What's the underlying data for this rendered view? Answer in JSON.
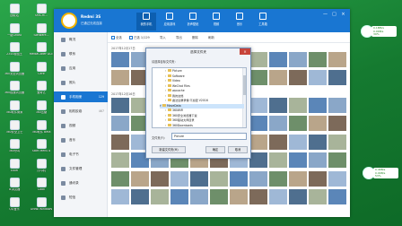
{
  "desktop": {
    "icons_left": [
      {
        "label": "回收站",
        "icon": "recycle-bin-icon"
      },
      {
        "label": "一键Ghost",
        "icon": "ghost-icon"
      },
      {
        "label": "2345看图王",
        "icon": "image-viewer-icon"
      },
      {
        "label": "360安全浏览器",
        "icon": "browser-icon"
      },
      {
        "label": "360极速浏览器",
        "icon": "browser-fast-icon"
      },
      {
        "label": "360软件管家",
        "icon": "software-manager-icon"
      },
      {
        "label": "360安全卫士",
        "icon": "security-guard-icon"
      },
      {
        "label": "360杀毒",
        "icon": "antivirus-icon"
      },
      {
        "label": "Excel",
        "icon": "excel-icon"
      },
      {
        "label": "IE浏览器",
        "icon": "ie-icon"
      },
      {
        "label": "QQ音乐",
        "icon": "qq-music-icon"
      }
    ],
    "icons_col2": [
      {
        "label": "SMS-Hi...",
        "icon": "sms-icon"
      },
      {
        "label": "Software...",
        "icon": "software-icon"
      },
      {
        "label": "MediaCoder ACE",
        "icon": "mediacoder-icon"
      },
      {
        "label": "Cere",
        "icon": "app-icon"
      },
      {
        "label": "爱奇艺",
        "icon": "video-icon"
      },
      {
        "label": "360压缩",
        "icon": "zip-icon"
      },
      {
        "label": "360软件 Beta",
        "icon": "beta-icon"
      },
      {
        "label": "Start Menu 8",
        "icon": "start-menu-icon"
      },
      {
        "label": "打印机",
        "icon": "printer-icon"
      },
      {
        "label": "Cook",
        "icon": "cook-icon"
      },
      {
        "label": "Growl Windows",
        "icon": "growl-icon"
      }
    ]
  },
  "window": {
    "app_name": "Redmi 3S",
    "app_subtitle": "已通过无线连接",
    "nav": [
      {
        "label": "我的手机",
        "icon": "phone-icon"
      },
      {
        "label": "应用游戏",
        "icon": "apps-icon"
      },
      {
        "label": "铃声壁纸",
        "icon": "ringtone-icon"
      },
      {
        "label": "视频",
        "icon": "video-icon"
      },
      {
        "label": "音乐",
        "icon": "music-icon"
      },
      {
        "label": "工具箱",
        "icon": "toolbox-icon"
      }
    ],
    "controls": {
      "min": "—",
      "max": "□",
      "close": "×"
    },
    "sidebar": [
      {
        "label": "概况",
        "count": ""
      },
      {
        "label": "联系",
        "count": ""
      },
      {
        "label": "应用",
        "count": ""
      },
      {
        "label": "照片",
        "count": ""
      },
      {
        "label": "手机相册",
        "count": "129"
      },
      {
        "label": "相机胶卷",
        "count": "467"
      },
      {
        "label": "视频",
        "count": ""
      },
      {
        "label": "音乐",
        "count": ""
      },
      {
        "label": "电子书",
        "count": ""
      },
      {
        "label": "文件管理",
        "count": ""
      },
      {
        "label": "通讯录",
        "count": ""
      },
      {
        "label": "短信",
        "count": ""
      }
    ],
    "toolbar": {
      "select_all": "全选",
      "selected": "已选 1/129",
      "import": "导入",
      "export": "导出",
      "delete": "删除",
      "refresh": "刷新"
    },
    "dates": [
      "2017年12月17日",
      "2017年12月16日"
    ]
  },
  "dialog": {
    "title": "选择文件夹",
    "prompt": "请选择目标文件夹：",
    "tree": [
      {
        "label": "Picture",
        "level": 2,
        "expanded": false
      },
      {
        "label": "Software",
        "level": 2,
        "expanded": false
      },
      {
        "label": "Video",
        "level": 2,
        "expanded": false
      },
      {
        "label": "WeChat Files",
        "level": 2,
        "expanded": false
      },
      {
        "label": "wpcache",
        "level": 2,
        "expanded": false
      },
      {
        "label": "我的文档",
        "level": 2,
        "expanded": false
      },
      {
        "label": "魔法全屏录像·不加密 V2016",
        "level": 2,
        "expanded": false
      },
      {
        "label": "MoveData",
        "level": 1,
        "expanded": true,
        "selected": true
      },
      {
        "label": "360WiFi",
        "level": 2,
        "expanded": false
      },
      {
        "label": "360安全浏览器下载",
        "level": 2,
        "expanded": false
      },
      {
        "label": "360驱动大师目录",
        "level": 2,
        "expanded": false
      },
      {
        "label": "360Downloads",
        "level": 2,
        "expanded": false
      }
    ],
    "folder_label": "文件夹(F):",
    "folder_value": "Picture",
    "buttons": {
      "new_folder": "新建文件夹(M)",
      "ok": "确定",
      "cancel": "取消"
    }
  },
  "widgets": {
    "top": {
      "line1": "0.1MB/s",
      "line2": "0.0KB/s",
      "percent": "39%"
    },
    "bottom": {
      "line1": "0.4KB/s",
      "line2": "0.0KB/s",
      "percent": "53%"
    }
  },
  "colors": {
    "accent": "#1976d2",
    "desktop": "#1f8a3a",
    "folder": "#e7c054"
  }
}
